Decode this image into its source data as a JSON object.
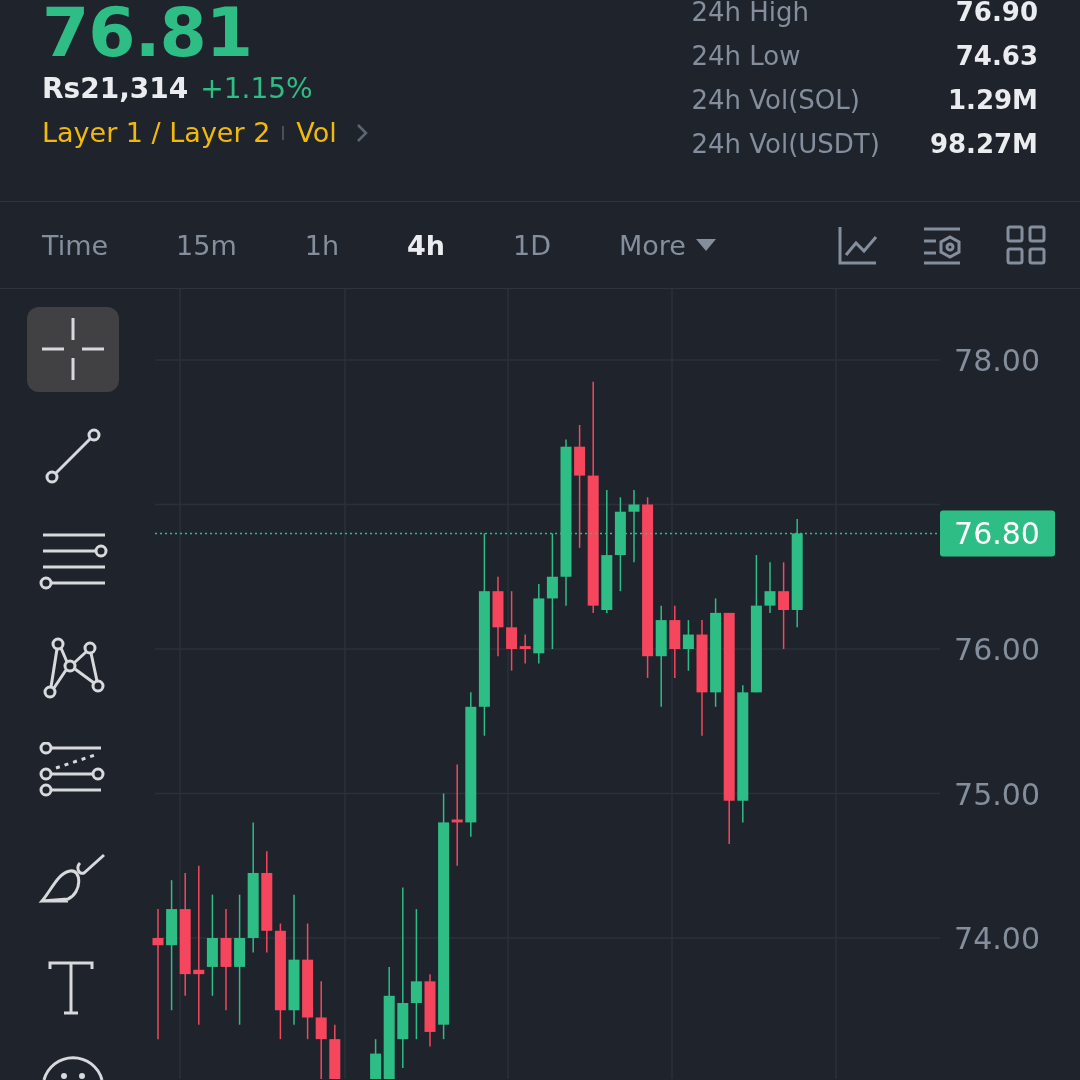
{
  "ticker": {
    "price": "76.81",
    "fiat_price": "Rs21,314",
    "change": "+1.15%",
    "tags": [
      "Layer 1 / Layer 2",
      "Vol"
    ]
  },
  "stats": [
    {
      "label": "24h High",
      "value": "76.90"
    },
    {
      "label": "24h Low",
      "value": "74.63"
    },
    {
      "label": "24h Vol(SOL)",
      "value": "1.29M"
    },
    {
      "label": "24h Vol(USDT)",
      "value": "98.27M"
    }
  ],
  "intervals": [
    {
      "label": "Time",
      "selected": false
    },
    {
      "label": "15m",
      "selected": false
    },
    {
      "label": "1h",
      "selected": false
    },
    {
      "label": "4h",
      "selected": true
    },
    {
      "label": "1D",
      "selected": false
    },
    {
      "label": "More",
      "selected": false
    }
  ],
  "drawing_tools": [
    {
      "kind": "crosshair",
      "selected": true
    },
    {
      "kind": "trendline",
      "selected": false
    },
    {
      "kind": "parallel",
      "selected": false
    },
    {
      "kind": "pattern",
      "selected": false
    },
    {
      "kind": "fib",
      "selected": false
    },
    {
      "kind": "brush",
      "selected": false
    },
    {
      "kind": "text",
      "selected": false
    },
    {
      "kind": "emoji",
      "selected": false
    }
  ],
  "chart": {
    "y_ticks": [
      "78.00",
      "76.00",
      "75.00",
      "74.00"
    ],
    "last_price": "76.80"
  }
}
